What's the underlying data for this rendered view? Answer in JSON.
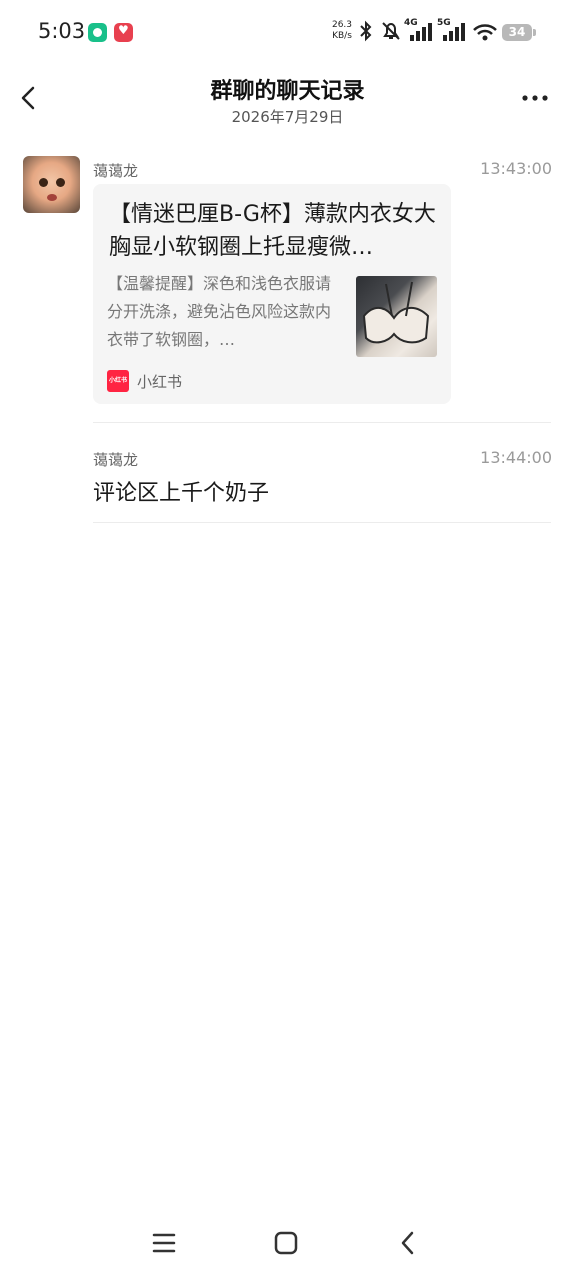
{
  "status_bar": {
    "time": "5:03",
    "net_speed_value": "26.3",
    "net_speed_unit": "KB/s",
    "signal1_label": "4G",
    "signal2_label": "5G",
    "battery": "34"
  },
  "header": {
    "title": "群聊的聊天记录",
    "date": "2026年7月29日"
  },
  "messages": [
    {
      "sender": "蔼蔼龙",
      "time": "13:43:00",
      "card": {
        "title": "【情迷巴厘B-G杯】薄款内衣女大胸显小软钢圈上托显瘦微…",
        "description": "【温馨提醒】深色和浅色衣服请分开洗涤，避免沾色风险这款内衣带了软钢圈，…",
        "source_icon_text": "小红书",
        "source": "小红书"
      }
    },
    {
      "sender": "蔼蔼龙",
      "time": "13:44:00",
      "text": "评论区上千个奶子"
    }
  ],
  "colors": {
    "accent_red": "#ff2442",
    "battery_gray": "#b8b8b8"
  }
}
